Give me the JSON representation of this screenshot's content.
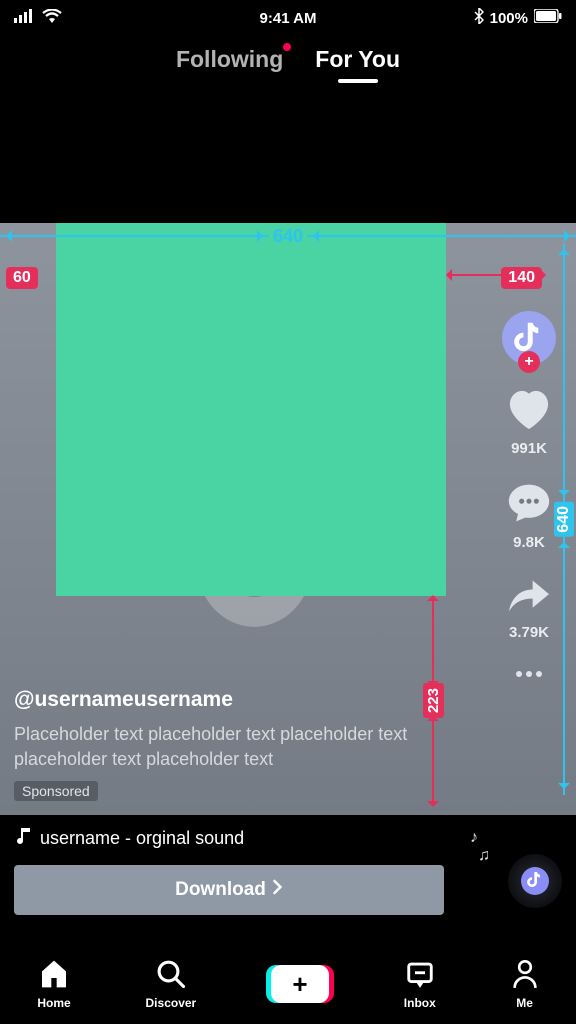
{
  "status_bar": {
    "time": "9:41 AM",
    "battery": "100%"
  },
  "tabs": {
    "following": "Following",
    "for_you": "For You",
    "active": "for_you",
    "has_following_notification": true
  },
  "annotations": {
    "width_label": "640",
    "height_label": "640",
    "left_margin": "60",
    "right_margin": "140",
    "bottom_caption_height": "223"
  },
  "video": {
    "username": "@usernameusername",
    "caption": "Placeholder text placeholder text placeholder text placeholder text placeholder text",
    "sponsored_label": "Sponsored"
  },
  "rail": {
    "likes": "991K",
    "comments": "9.8K",
    "shares": "3.79K"
  },
  "sound": {
    "label": "username - orginal sound"
  },
  "cta": {
    "label": "Download"
  },
  "nav": {
    "home": "Home",
    "discover": "Discover",
    "inbox": "Inbox",
    "me": "Me"
  }
}
